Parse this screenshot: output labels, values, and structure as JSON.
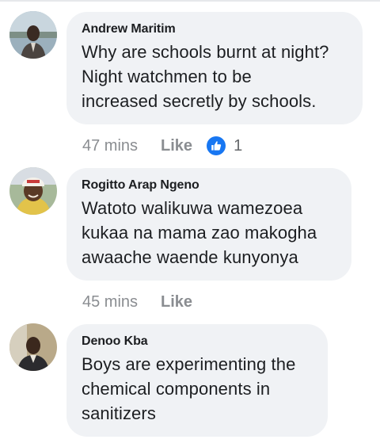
{
  "comments": [
    {
      "author": "Andrew Maritim",
      "text": [
        "Why are schools burnt at night?",
        "Night watchmen to be",
        "increased secretly by schools."
      ],
      "time": "47 mins",
      "like_label": "Like",
      "reaction_count": "1"
    },
    {
      "author": "Rogitto Arap Ngeno",
      "text": [
        "Watoto walikuwa wamezoea",
        "kukaa na mama zao makogha",
        "awaache waende kunyonya"
      ],
      "time": "45 mins",
      "like_label": "Like"
    },
    {
      "author": "Denoo Kba",
      "text": [
        "Boys are experimenting the",
        "chemical components in",
        "sanitizers"
      ]
    }
  ],
  "colors": {
    "bubble": "#f0f2f5",
    "like_reaction": "#1877f2",
    "meta_text": "#8a8d91"
  },
  "icons": {
    "like_reaction": "thumbs-up-icon"
  }
}
